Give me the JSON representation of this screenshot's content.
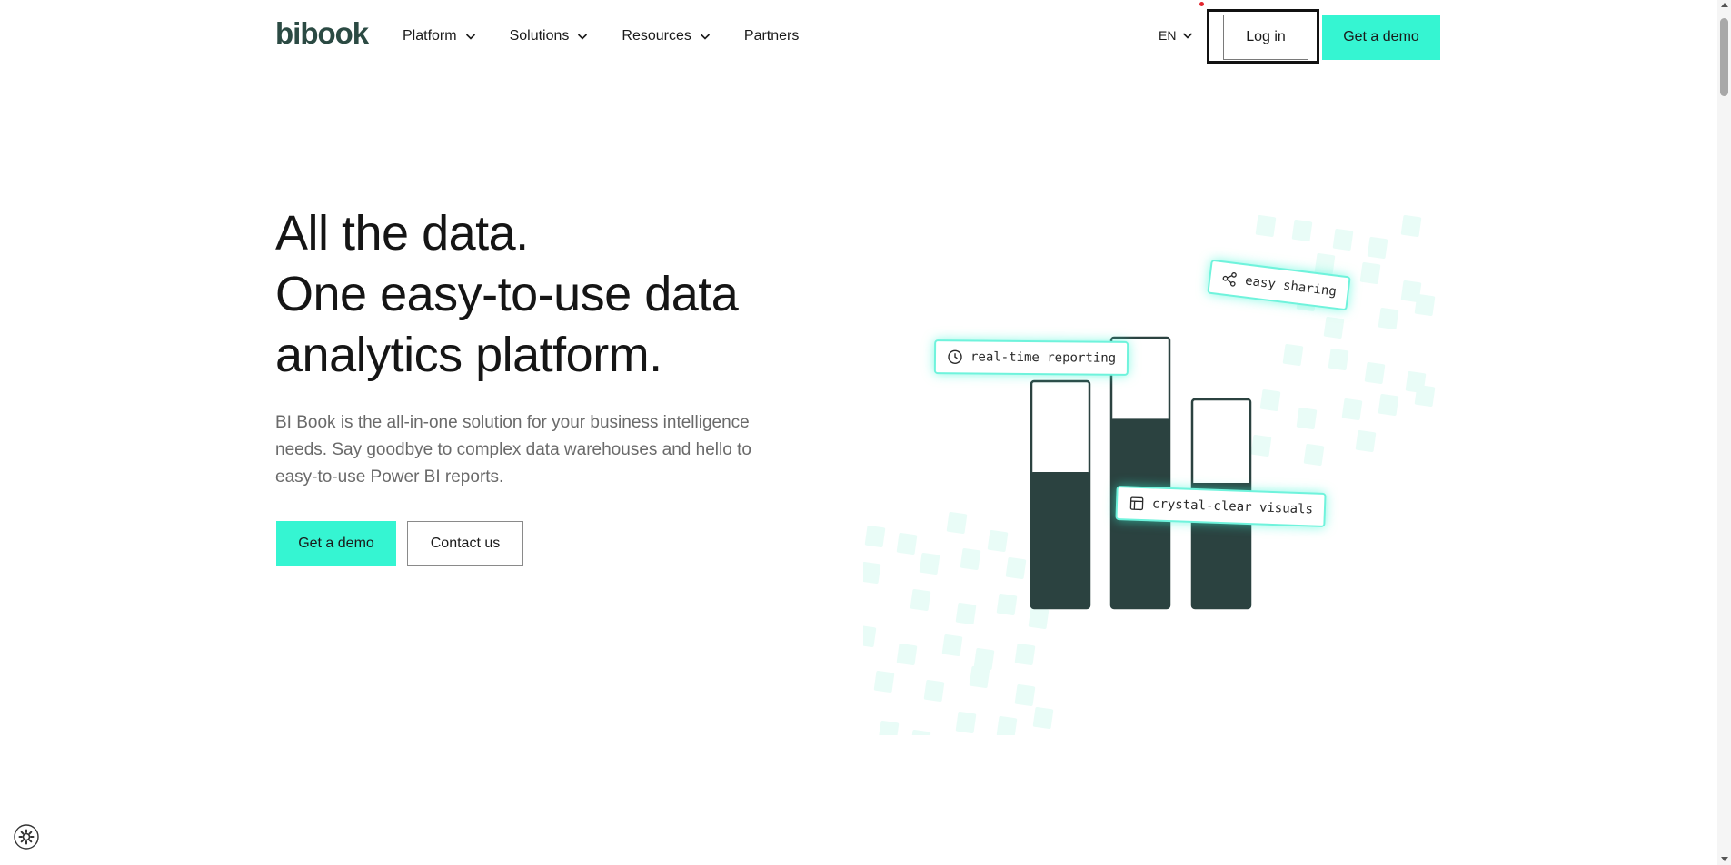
{
  "header": {
    "logo": "bibook",
    "nav": [
      {
        "label": "Platform",
        "has_dropdown": true
      },
      {
        "label": "Solutions",
        "has_dropdown": true
      },
      {
        "label": "Resources",
        "has_dropdown": true
      },
      {
        "label": "Partners",
        "has_dropdown": false
      }
    ],
    "language": "EN",
    "login_label": "Log in",
    "demo_label": "Get a demo"
  },
  "hero": {
    "title_lines": [
      "All the data.",
      "One easy-to-use data",
      "analytics platform."
    ],
    "description": "BI Book is the all-in-one solution for your business intelligence needs. Say goodbye to complex data warehouses and hello to easy-to-use Power BI reports.",
    "primary_cta": "Get a demo",
    "secondary_cta": "Contact us"
  },
  "illustration": {
    "tags": {
      "realtime": "real-time reporting",
      "sharing": "easy sharing",
      "visuals": "crystal-clear visuals"
    },
    "bar_fill_levels": [
      0.6,
      0.7,
      0.6
    ],
    "accent_color": "#35f5d2",
    "bar_color": "#2b4240",
    "tile_color": "#e9fcf7"
  },
  "colors": {
    "accent": "#35f5d2",
    "logo": "#2b4a43",
    "focus_ring": "#111111",
    "notification_dot": "#e3262e"
  },
  "icons": {
    "nav_dropdown": "chevron-down-icon",
    "settings": "cookie-settings-icon",
    "realtime": "clock-icon",
    "sharing": "share-icon",
    "visuals": "layout-icon"
  }
}
